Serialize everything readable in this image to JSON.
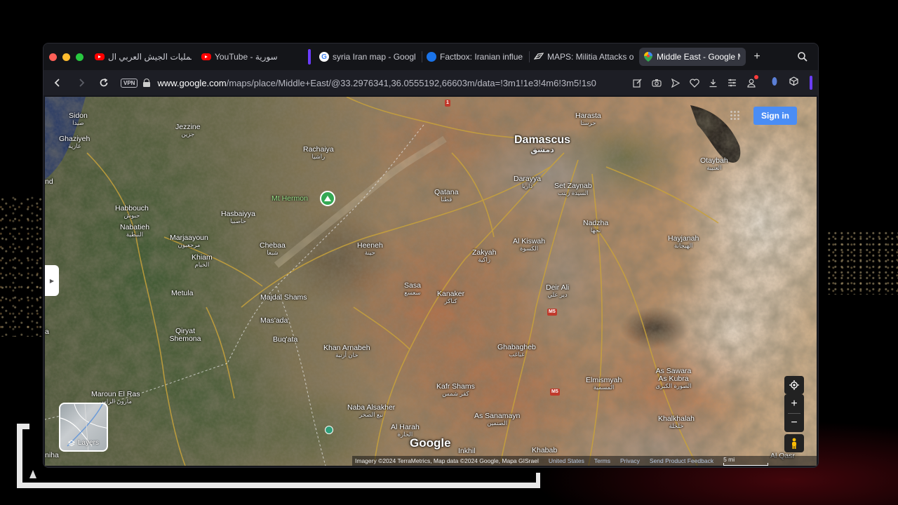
{
  "browser": {
    "tabs": [
      {
        "title": "من عمليات الجيش العربي ال...",
        "icon": "youtube-icon"
      },
      {
        "title": "YouTube - سورية",
        "icon": "youtube-icon"
      },
      {
        "title": "syria Iran map - Google",
        "icon": "google-icon"
      },
      {
        "title": "Factbox: Iranian influenc",
        "icon": "globe-icon"
      },
      {
        "title": "MAPS: Militia Attacks on",
        "icon": "news-icon"
      },
      {
        "title": "Middle East - Google Ma",
        "icon": "google-maps-icon",
        "active": true
      }
    ],
    "vpn_label": "VPN",
    "url_host": "www.google.com",
    "url_path": "/maps/place/Middle+East/@33.2976341,36.0555192,66603m/data=!3m1!1e3!4m6!3m5!1s0"
  },
  "map": {
    "sign_in": "Sign in",
    "layers_label": "Layers",
    "google_logo": "Google",
    "attribution": "Imagery ©2024 TerraMetrics, Map data ©2024 Google, Mapa GISrael",
    "links": [
      "United States",
      "Terms",
      "Privacy",
      "Send Product Feedback"
    ],
    "scale_label": "5 mi",
    "highways": [
      "1",
      "M5",
      "M5"
    ],
    "places": [
      {
        "name": "Sidon",
        "ar": "صيدا"
      },
      {
        "name": "Ghaziyeh",
        "ar": "غازية"
      },
      {
        "name": "Jezzine",
        "ar": "جزين"
      },
      {
        "name": "Rachaiya",
        "ar": "راشيا"
      },
      {
        "name": "Damascus",
        "ar": "دمشق"
      },
      {
        "name": "Harasta",
        "ar": "حرستا"
      },
      {
        "name": "Otaybah",
        "ar": "العتيبة"
      },
      {
        "name": "Darayya",
        "ar": "داريا"
      },
      {
        "name": "Set Zaynab",
        "ar": "السيدة زينب"
      },
      {
        "name": "Qatana",
        "ar": "قطنا"
      },
      {
        "name": "Mt Hermon",
        "ar": ""
      },
      {
        "name": "Habbouch",
        "ar": "حبوش"
      },
      {
        "name": "Nabatieh",
        "ar": "النبطية"
      },
      {
        "name": "Hasbaiyya",
        "ar": "حاصبيا"
      },
      {
        "name": "Marjaayoun",
        "ar": "مرجعيون"
      },
      {
        "name": "Khiam",
        "ar": "الخيام"
      },
      {
        "name": "Chebaa",
        "ar": "شبعا"
      },
      {
        "name": "Heeneh",
        "ar": "حينة"
      },
      {
        "name": "Zakyah",
        "ar": "زاكية"
      },
      {
        "name": "Al Kiswah",
        "ar": "الكسوة"
      },
      {
        "name": "Nadzha",
        "ar": "نجها"
      },
      {
        "name": "Hayjanah",
        "ar": "الهيجانة"
      },
      {
        "name": "Metula",
        "ar": ""
      },
      {
        "name": "Majdal Shams",
        "ar": ""
      },
      {
        "name": "Sasa",
        "ar": "سعسع"
      },
      {
        "name": "Kanaker",
        "ar": "كناكر"
      },
      {
        "name": "Deir Ali",
        "ar": "دير علي"
      },
      {
        "name": "Qiryat Shemona",
        "ar": ""
      },
      {
        "name": "Mas'ada",
        "ar": ""
      },
      {
        "name": "Buq'ata",
        "ar": ""
      },
      {
        "name": "Khan Arnabeh",
        "ar": "خان أرنبة"
      },
      {
        "name": "Ghabagheb",
        "ar": "غباغب"
      },
      {
        "name": "Elmismyah",
        "ar": "المسمية"
      },
      {
        "name": "As Sawara As Kubra",
        "ar": "الصورة الكبرى"
      },
      {
        "name": "Maroun El Ras",
        "ar": "مارون الراس"
      },
      {
        "name": "Kafr Shams",
        "ar": "كفر شمس"
      },
      {
        "name": "Naba Alsakher",
        "ar": "نبع الصخر"
      },
      {
        "name": "As Sanamayn",
        "ar": "الصنمين"
      },
      {
        "name": "Al Harah",
        "ar": "الحارة"
      },
      {
        "name": "Khalkhalah",
        "ar": "خلخلة"
      },
      {
        "name": "Inkhil",
        "ar": ""
      },
      {
        "name": "Khabab",
        "ar": ""
      },
      {
        "name": "Al Qasr",
        "ar": ""
      },
      {
        "name": "nd",
        "ar": ""
      },
      {
        "name": "a",
        "ar": ""
      },
      {
        "name": "niha",
        "ar": ""
      }
    ]
  }
}
